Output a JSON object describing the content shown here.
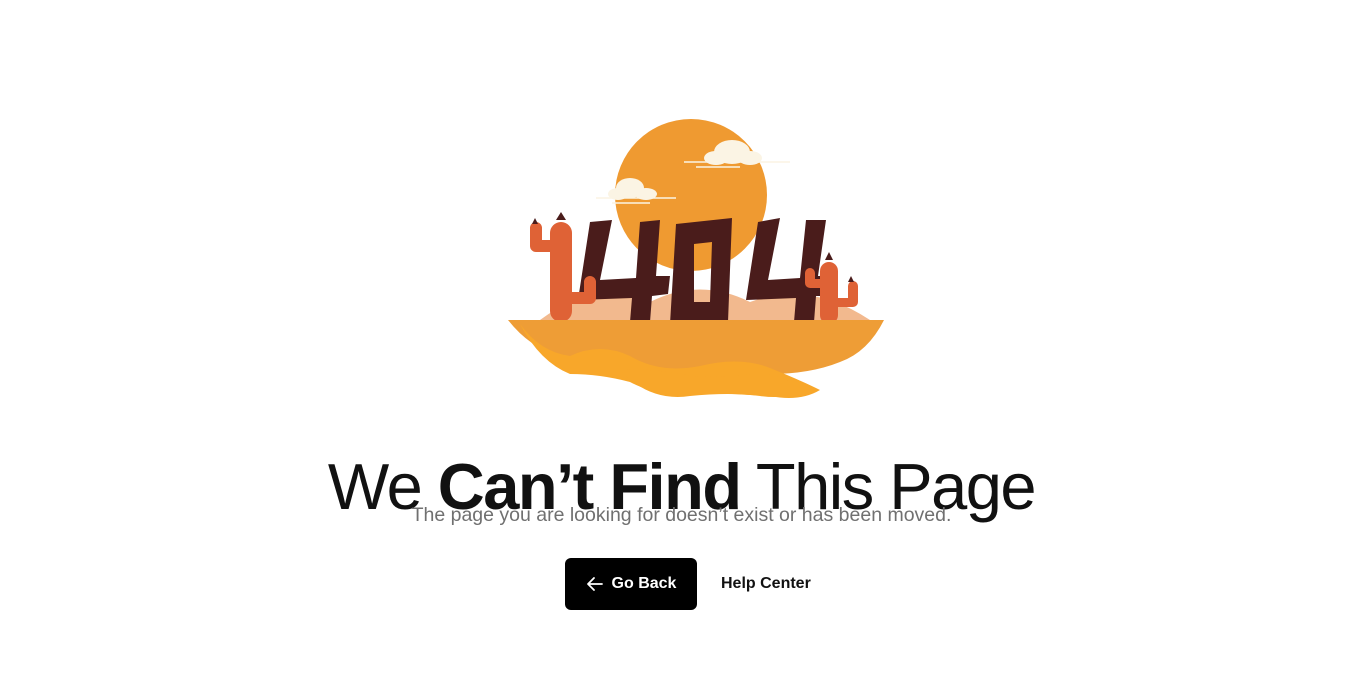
{
  "illustration": {
    "icon": "desert-404-illustration",
    "code_text": "404",
    "colors": {
      "sun": "#ef9a31",
      "sand_top": "#f2b98e",
      "sand_back": "#ee9d36",
      "sand_front": "#f8a72a",
      "digits": "#4a1c1b",
      "cactus": "#df6236",
      "cloud": "#fbf4e4"
    }
  },
  "headline": {
    "part1": "We ",
    "part2": "Can’t Find",
    "part3": " This Page"
  },
  "subtitle": "The page you are looking for doesn’t exist or has been moved.",
  "actions": {
    "go_back": {
      "icon": "arrow-left-icon",
      "label": "Go Back"
    },
    "help_center": {
      "label": "Help Center"
    }
  }
}
